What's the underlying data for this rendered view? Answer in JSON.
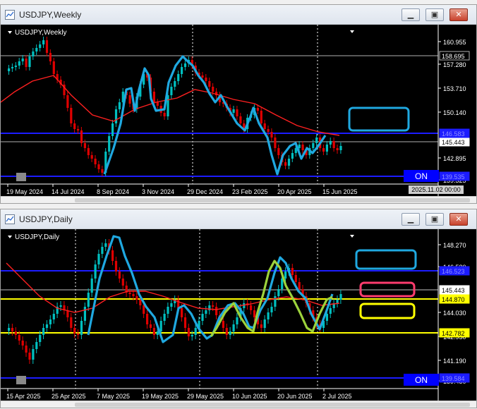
{
  "weekly": {
    "window_title": "USDJPY,Weekly",
    "chart_label": "USDJPY,Weekly",
    "on_label": "ON",
    "date_label": "2025.11.02 00:00",
    "x_labels": [
      "19 May 2024",
      "14 Jul 2024",
      "8 Sep 2024",
      "3 Nov 2024",
      "29 Dec 2024",
      "23 Feb 2025",
      "20 Apr 2025",
      "15 Jun 2025"
    ],
    "y_labels": [
      "160.955",
      "157.280",
      "153.710",
      "150.140",
      "142.895",
      "139.325"
    ],
    "price_tags": [
      {
        "value": "158.695",
        "kind": "line"
      },
      {
        "value": "145.443",
        "kind": "bid"
      },
      {
        "value": "146.583",
        "kind": "blue"
      },
      {
        "value": "139.535",
        "kind": "blue"
      }
    ]
  },
  "daily": {
    "window_title": "USDJPY,Daily",
    "chart_label": "USDJPY,Daily",
    "on_label": "ON",
    "x_labels": [
      "15 Apr 2025",
      "25 Apr 2025",
      "7 May 2025",
      "19 May 2025",
      "29 May 2025",
      "10 Jun 2025",
      "20 Jun 2025",
      "2 Jul 2025"
    ],
    "y_labels": [
      "148.270",
      "146.530",
      "144.030",
      "142.950",
      "141.190",
      "139.450"
    ],
    "price_tags": [
      {
        "value": "146.523",
        "kind": "blue"
      },
      {
        "value": "145.443",
        "kind": "bid"
      },
      {
        "value": "144.870",
        "kind": "yellow"
      },
      {
        "value": "142.782",
        "kind": "yellow"
      },
      {
        "value": "139.584",
        "kind": "blue"
      }
    ]
  },
  "colors": {
    "bull": "#00c0c0",
    "bear": "#e00000",
    "ma": "#ff2020",
    "hline": "#1c1cff",
    "yellow": "#ffff00",
    "wave": "#1fa8e0",
    "green_wave": "#9cd23c",
    "pink_box": "#ff3c6e"
  },
  "icons": {
    "window": "chart-window-icon",
    "minimize": "minimize-icon",
    "restore": "restore-icon",
    "close": "close-icon"
  }
}
